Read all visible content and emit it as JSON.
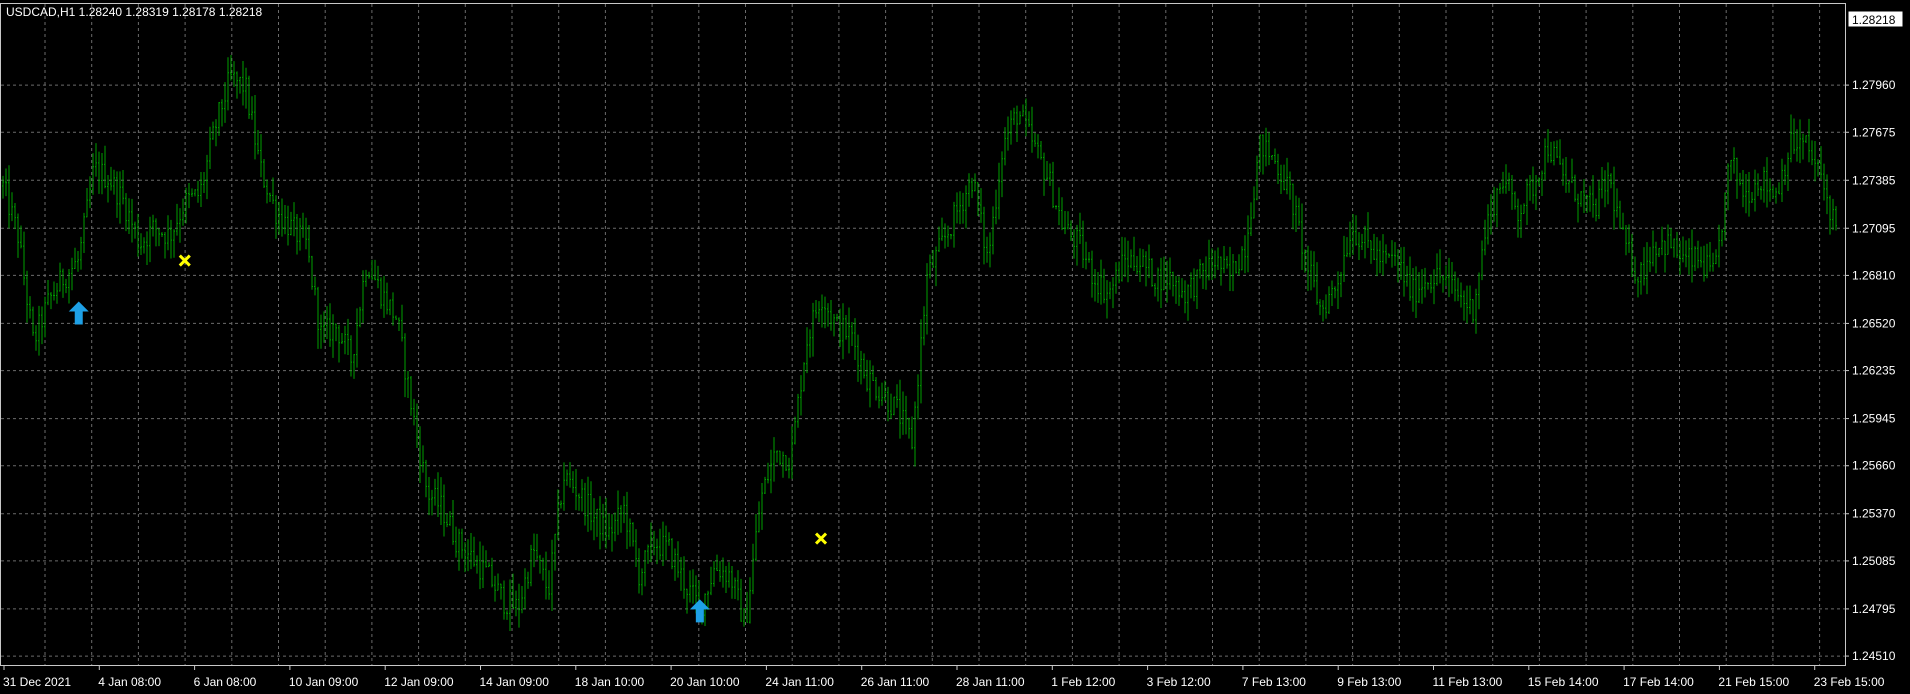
{
  "chart_data": {
    "type": "line",
    "symbol_label": "USDCAD,H1  1.28240 1.28319 1.28178 1.28218",
    "current_price": "1.28218",
    "ylim": [
      1.2445,
      1.2845
    ],
    "y_ticks": [
      "1.27960",
      "1.27675",
      "1.27385",
      "1.27095",
      "1.26810",
      "1.26520",
      "1.26235",
      "1.25945",
      "1.25660",
      "1.25370",
      "1.25085",
      "1.24795",
      "1.24510"
    ],
    "x_ticks": [
      "31 Dec 2021",
      "4 Jan 08:00",
      "6 Jan 08:00",
      "10 Jan 09:00",
      "12 Jan 09:00",
      "14 Jan 09:00",
      "18 Jan 10:00",
      "20 Jan 10:00",
      "24 Jan 11:00",
      "26 Jan 11:00",
      "28 Jan 11:00",
      "1 Feb 12:00",
      "3 Feb 12:00",
      "7 Feb 13:00",
      "9 Feb 13:00",
      "11 Feb 13:00",
      "15 Feb 14:00",
      "17 Feb 14:00",
      "21 Feb 15:00",
      "23 Feb 15:00"
    ],
    "grid": true,
    "colors": {
      "background": "#000000",
      "bars": "#00a000",
      "grid": "#6b6b6b",
      "up_arrow": "#1ea0e6",
      "cross": "#ffff00",
      "text": "#ffffff"
    },
    "series": [
      {
        "values": [
          1.2735,
          1.2705,
          1.264,
          1.2665,
          1.268,
          1.269,
          1.2745,
          1.274,
          1.2725,
          1.27,
          1.271,
          1.2705,
          1.2725,
          1.273,
          1.277,
          1.28,
          1.2795,
          1.2745,
          1.272,
          1.271,
          1.27,
          1.2645,
          1.265,
          1.263,
          1.269,
          1.267,
          1.2655,
          1.26,
          1.255,
          1.254,
          1.252,
          1.251,
          1.25,
          1.2485,
          1.248,
          1.2515,
          1.249,
          1.256,
          1.255,
          1.2535,
          1.2525,
          1.254,
          1.25,
          1.252,
          1.2515,
          1.2495,
          1.248,
          1.2505,
          1.25,
          1.247,
          1.2545,
          1.2575,
          1.257,
          1.264,
          1.267,
          1.265,
          1.2645,
          1.262,
          1.261,
          1.26,
          1.258,
          1.268,
          1.27,
          1.272,
          1.274,
          1.269,
          1.276,
          1.278,
          1.276,
          1.274,
          1.271,
          1.27,
          1.268,
          1.267,
          1.269,
          1.269,
          1.268,
          1.268,
          1.267,
          1.268,
          1.269,
          1.268,
          1.27,
          1.276,
          1.275,
          1.273,
          1.269,
          1.266,
          1.2675,
          1.271,
          1.27,
          1.269,
          1.269,
          1.267,
          1.268,
          1.268,
          1.267,
          1.266,
          1.2715,
          1.274,
          1.272,
          1.2735,
          1.276,
          1.274,
          1.273,
          1.272,
          1.274,
          1.27,
          1.268,
          1.27,
          1.27,
          1.269,
          1.269,
          1.268,
          1.275,
          1.273,
          1.274,
          1.273,
          1.276,
          1.276,
          1.274,
          1.271
        ]
      }
    ],
    "markers": [
      {
        "type": "up_arrow",
        "x": 5,
        "y": 1.2658
      },
      {
        "type": "cross",
        "x": 12,
        "y": 1.269
      },
      {
        "type": "up_arrow",
        "x": 46,
        "y": 1.2478
      },
      {
        "type": "cross",
        "x": 54,
        "y": 1.2522
      }
    ]
  }
}
